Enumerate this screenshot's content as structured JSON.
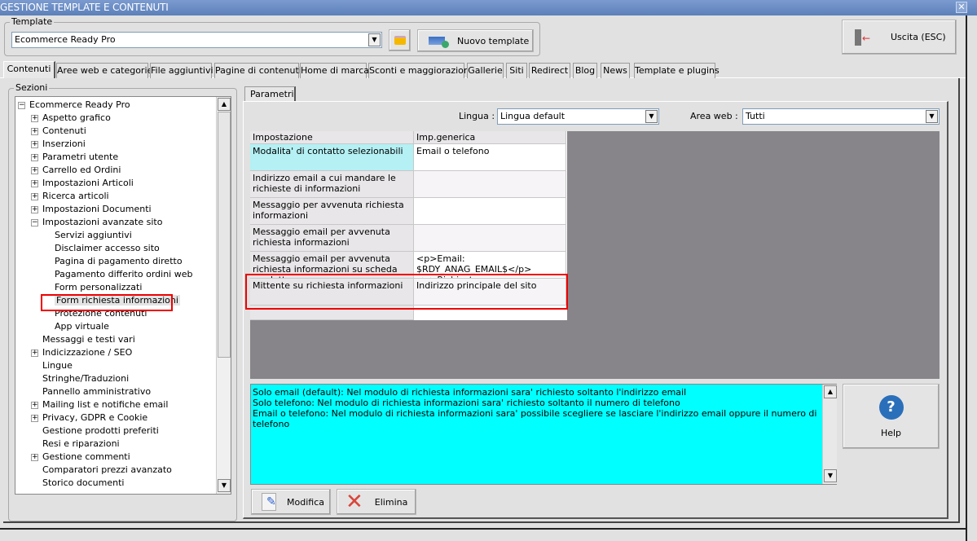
{
  "window": {
    "title": "GESTIONE TEMPLATE E CONTENUTI",
    "close": "✕"
  },
  "template": {
    "group_label": "Template",
    "selected": "Ecommerce Ready Pro",
    "new_button": "Nuovo template",
    "exit_button": "Uscita (ESC)"
  },
  "tabs": [
    "Contenuti",
    "Aree web e categorie",
    "File aggiuntivi",
    "Pagine di contenuti",
    "Home di marca",
    "Sconti e maggiorazioni",
    "Gallerie",
    "Siti",
    "Redirect",
    "Blog",
    "News",
    "Template e plugins"
  ],
  "sections": {
    "group_label": "Sezioni",
    "root": "Ecommerce Ready Pro",
    "items": [
      {
        "label": "Aspetto grafico",
        "level": 1,
        "expander": "+"
      },
      {
        "label": "Contenuti",
        "level": 1,
        "expander": "+"
      },
      {
        "label": "Inserzioni",
        "level": 1,
        "expander": "+"
      },
      {
        "label": "Parametri utente",
        "level": 1,
        "expander": "+"
      },
      {
        "label": "Carrello ed Ordini",
        "level": 1,
        "expander": "+"
      },
      {
        "label": "Impostazioni Articoli",
        "level": 1,
        "expander": "+"
      },
      {
        "label": "Ricerca articoli",
        "level": 1,
        "expander": "+"
      },
      {
        "label": "Impostazioni Documenti",
        "level": 1,
        "expander": "+"
      },
      {
        "label": "Impostazioni avanzate sito",
        "level": 1,
        "expander": "−"
      },
      {
        "label": "Servizi aggiuntivi",
        "level": 2
      },
      {
        "label": "Disclaimer accesso sito",
        "level": 2
      },
      {
        "label": "Pagina di pagamento diretto",
        "level": 2
      },
      {
        "label": "Pagamento differito ordini web",
        "level": 2
      },
      {
        "label": "Form personalizzati",
        "level": 2
      },
      {
        "label": "Form richiesta informazioni",
        "level": 2,
        "selected": true
      },
      {
        "label": "Protezione contenuti",
        "level": 2
      },
      {
        "label": "App virtuale",
        "level": 2
      },
      {
        "label": "Messaggi e testi vari",
        "level": 1
      },
      {
        "label": "Indicizzazione / SEO",
        "level": 1,
        "expander": "+"
      },
      {
        "label": "Lingue",
        "level": 1
      },
      {
        "label": "Stringhe/Traduzioni",
        "level": 1
      },
      {
        "label": "Pannello amministrativo",
        "level": 1
      },
      {
        "label": "Mailing list e notifiche email",
        "level": 1,
        "expander": "+"
      },
      {
        "label": "Privacy, GDPR e Cookie",
        "level": 1,
        "expander": "+"
      },
      {
        "label": "Gestione prodotti preferiti",
        "level": 1
      },
      {
        "label": "Resi e riparazioni",
        "level": 1
      },
      {
        "label": "Gestione commenti",
        "level": 1,
        "expander": "+"
      },
      {
        "label": "Comparatori prezzi avanzato",
        "level": 1
      },
      {
        "label": "Storico documenti",
        "level": 1
      }
    ]
  },
  "params": {
    "tab": "Parametri",
    "lingua_label": "Lingua :",
    "lingua_value": "Lingua default",
    "area_label": "Area web :",
    "area_value": "Tutti",
    "columns": [
      "Impostazione",
      "Imp.generica"
    ],
    "rows": [
      {
        "setting": "Modalita' di contatto selezionabili",
        "value": "Email o telefono"
      },
      {
        "setting": "Indirizzo email a cui mandare le richieste di informazioni",
        "value": ""
      },
      {
        "setting": "Messaggio per avvenuta richiesta informazioni",
        "value": ""
      },
      {
        "setting": "Messaggio email per avvenuta richiesta informazioni",
        "value": ""
      },
      {
        "setting": "Messaggio email per avvenuta richiesta informazioni su scheda prodotto",
        "value": "<p>Email: $RDY_ANAG_EMAIL$</p> <p>Richiesta:"
      },
      {
        "setting": "Mittente su richiesta informazioni",
        "value": "Indirizzo principale del sito"
      }
    ],
    "help_lines": [
      "Solo email (default): Nel modulo di richiesta informazioni sara' richiesto soltanto l'indirizzo email",
      "Solo telefono: Nel modulo di richiesta informazioni sara' richiesto soltanto il numero di telefono",
      "Email o telefono: Nel modulo di richiesta informazioni sara' possibile scegliere se lasciare l'indirizzo email oppure il numero di telefono"
    ],
    "help_button": "Help",
    "help_icon": "?",
    "modify_button": "Modifica",
    "delete_button": "Elimina"
  }
}
